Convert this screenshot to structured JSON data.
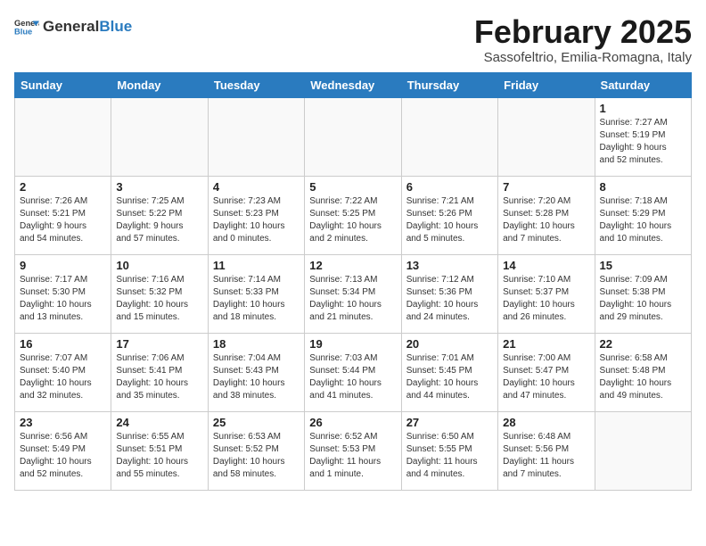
{
  "header": {
    "logo_general": "General",
    "logo_blue": "Blue",
    "title": "February 2025",
    "subtitle": "Sassofeltrio, Emilia-Romagna, Italy"
  },
  "weekdays": [
    "Sunday",
    "Monday",
    "Tuesday",
    "Wednesday",
    "Thursday",
    "Friday",
    "Saturday"
  ],
  "weeks": [
    [
      {
        "day": "",
        "info": ""
      },
      {
        "day": "",
        "info": ""
      },
      {
        "day": "",
        "info": ""
      },
      {
        "day": "",
        "info": ""
      },
      {
        "day": "",
        "info": ""
      },
      {
        "day": "",
        "info": ""
      },
      {
        "day": "1",
        "info": "Sunrise: 7:27 AM\nSunset: 5:19 PM\nDaylight: 9 hours\nand 52 minutes."
      }
    ],
    [
      {
        "day": "2",
        "info": "Sunrise: 7:26 AM\nSunset: 5:21 PM\nDaylight: 9 hours\nand 54 minutes."
      },
      {
        "day": "3",
        "info": "Sunrise: 7:25 AM\nSunset: 5:22 PM\nDaylight: 9 hours\nand 57 minutes."
      },
      {
        "day": "4",
        "info": "Sunrise: 7:23 AM\nSunset: 5:23 PM\nDaylight: 10 hours\nand 0 minutes."
      },
      {
        "day": "5",
        "info": "Sunrise: 7:22 AM\nSunset: 5:25 PM\nDaylight: 10 hours\nand 2 minutes."
      },
      {
        "day": "6",
        "info": "Sunrise: 7:21 AM\nSunset: 5:26 PM\nDaylight: 10 hours\nand 5 minutes."
      },
      {
        "day": "7",
        "info": "Sunrise: 7:20 AM\nSunset: 5:28 PM\nDaylight: 10 hours\nand 7 minutes."
      },
      {
        "day": "8",
        "info": "Sunrise: 7:18 AM\nSunset: 5:29 PM\nDaylight: 10 hours\nand 10 minutes."
      }
    ],
    [
      {
        "day": "9",
        "info": "Sunrise: 7:17 AM\nSunset: 5:30 PM\nDaylight: 10 hours\nand 13 minutes."
      },
      {
        "day": "10",
        "info": "Sunrise: 7:16 AM\nSunset: 5:32 PM\nDaylight: 10 hours\nand 15 minutes."
      },
      {
        "day": "11",
        "info": "Sunrise: 7:14 AM\nSunset: 5:33 PM\nDaylight: 10 hours\nand 18 minutes."
      },
      {
        "day": "12",
        "info": "Sunrise: 7:13 AM\nSunset: 5:34 PM\nDaylight: 10 hours\nand 21 minutes."
      },
      {
        "day": "13",
        "info": "Sunrise: 7:12 AM\nSunset: 5:36 PM\nDaylight: 10 hours\nand 24 minutes."
      },
      {
        "day": "14",
        "info": "Sunrise: 7:10 AM\nSunset: 5:37 PM\nDaylight: 10 hours\nand 26 minutes."
      },
      {
        "day": "15",
        "info": "Sunrise: 7:09 AM\nSunset: 5:38 PM\nDaylight: 10 hours\nand 29 minutes."
      }
    ],
    [
      {
        "day": "16",
        "info": "Sunrise: 7:07 AM\nSunset: 5:40 PM\nDaylight: 10 hours\nand 32 minutes."
      },
      {
        "day": "17",
        "info": "Sunrise: 7:06 AM\nSunset: 5:41 PM\nDaylight: 10 hours\nand 35 minutes."
      },
      {
        "day": "18",
        "info": "Sunrise: 7:04 AM\nSunset: 5:43 PM\nDaylight: 10 hours\nand 38 minutes."
      },
      {
        "day": "19",
        "info": "Sunrise: 7:03 AM\nSunset: 5:44 PM\nDaylight: 10 hours\nand 41 minutes."
      },
      {
        "day": "20",
        "info": "Sunrise: 7:01 AM\nSunset: 5:45 PM\nDaylight: 10 hours\nand 44 minutes."
      },
      {
        "day": "21",
        "info": "Sunrise: 7:00 AM\nSunset: 5:47 PM\nDaylight: 10 hours\nand 47 minutes."
      },
      {
        "day": "22",
        "info": "Sunrise: 6:58 AM\nSunset: 5:48 PM\nDaylight: 10 hours\nand 49 minutes."
      }
    ],
    [
      {
        "day": "23",
        "info": "Sunrise: 6:56 AM\nSunset: 5:49 PM\nDaylight: 10 hours\nand 52 minutes."
      },
      {
        "day": "24",
        "info": "Sunrise: 6:55 AM\nSunset: 5:51 PM\nDaylight: 10 hours\nand 55 minutes."
      },
      {
        "day": "25",
        "info": "Sunrise: 6:53 AM\nSunset: 5:52 PM\nDaylight: 10 hours\nand 58 minutes."
      },
      {
        "day": "26",
        "info": "Sunrise: 6:52 AM\nSunset: 5:53 PM\nDaylight: 11 hours\nand 1 minute."
      },
      {
        "day": "27",
        "info": "Sunrise: 6:50 AM\nSunset: 5:55 PM\nDaylight: 11 hours\nand 4 minutes."
      },
      {
        "day": "28",
        "info": "Sunrise: 6:48 AM\nSunset: 5:56 PM\nDaylight: 11 hours\nand 7 minutes."
      },
      {
        "day": "",
        "info": ""
      }
    ]
  ]
}
